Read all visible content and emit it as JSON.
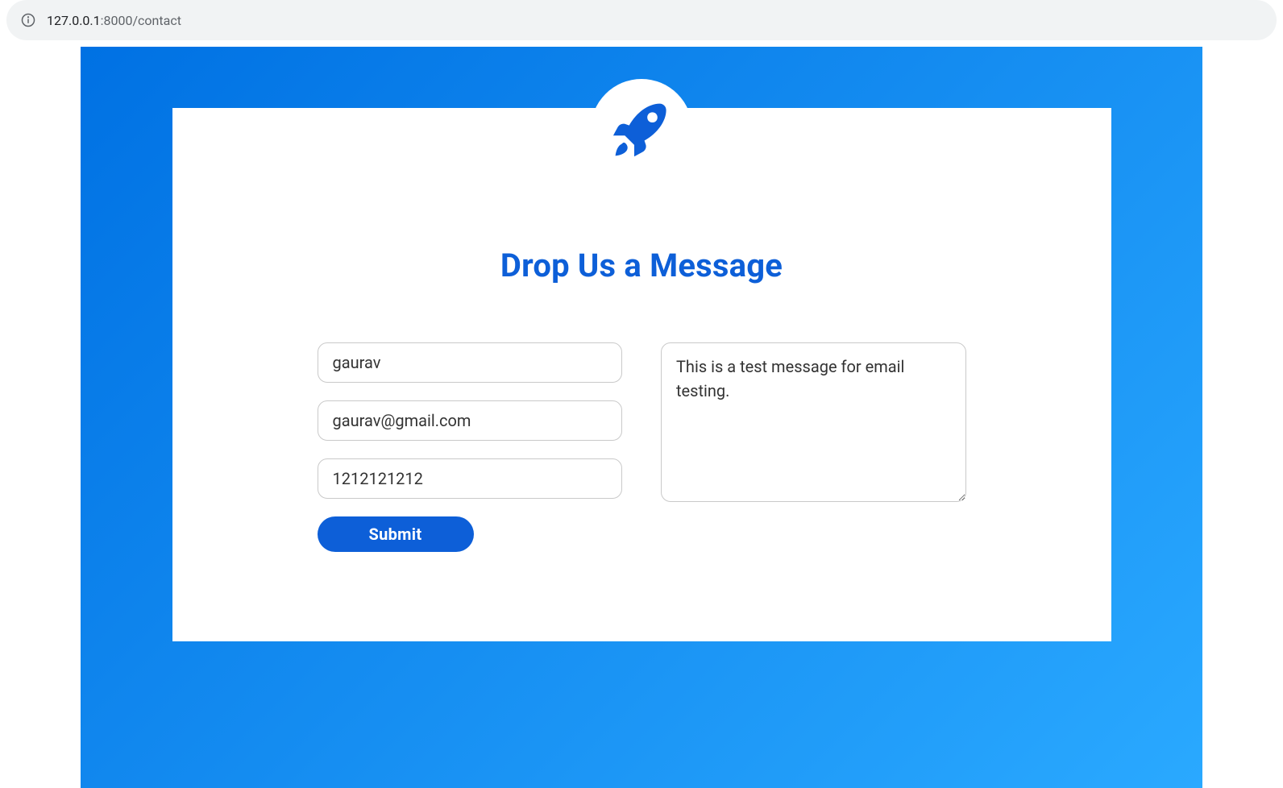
{
  "browser": {
    "url_host": "127.0.0.1",
    "url_rest": ":8000/contact"
  },
  "page": {
    "title": "Drop Us a Message"
  },
  "form": {
    "name_value": "gaurav",
    "email_value": "gaurav@gmail.com",
    "phone_value": "1212121212",
    "message_value": "This is a test message for email testing.",
    "submit_label": "Submit"
  },
  "colors": {
    "accent": "#0d5fd8",
    "gradient_start": "#0071e3",
    "gradient_end": "#2aa9ff"
  }
}
